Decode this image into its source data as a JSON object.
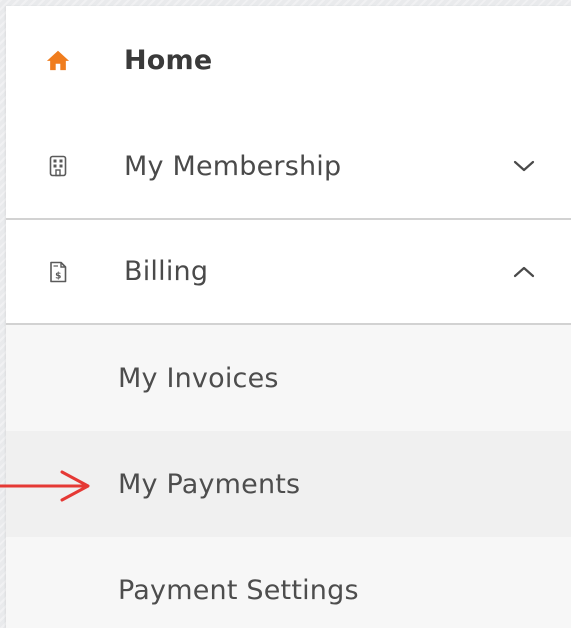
{
  "colors": {
    "accent": "#f07d1e",
    "arrow": "#e53935",
    "text": "#4a4a4a",
    "divider": "#d2d2d2",
    "submenu_bg": "#f7f7f7"
  },
  "menu": {
    "home": {
      "label": "Home",
      "icon": "home-icon"
    },
    "membership": {
      "label": "My Membership",
      "icon": "building-icon",
      "expanded": false
    },
    "billing": {
      "label": "Billing",
      "icon": "invoice-icon",
      "expanded": true,
      "items": [
        {
          "label": "My Invoices"
        },
        {
          "label": "My Payments",
          "highlighted": true
        },
        {
          "label": "Payment Settings"
        }
      ]
    }
  }
}
